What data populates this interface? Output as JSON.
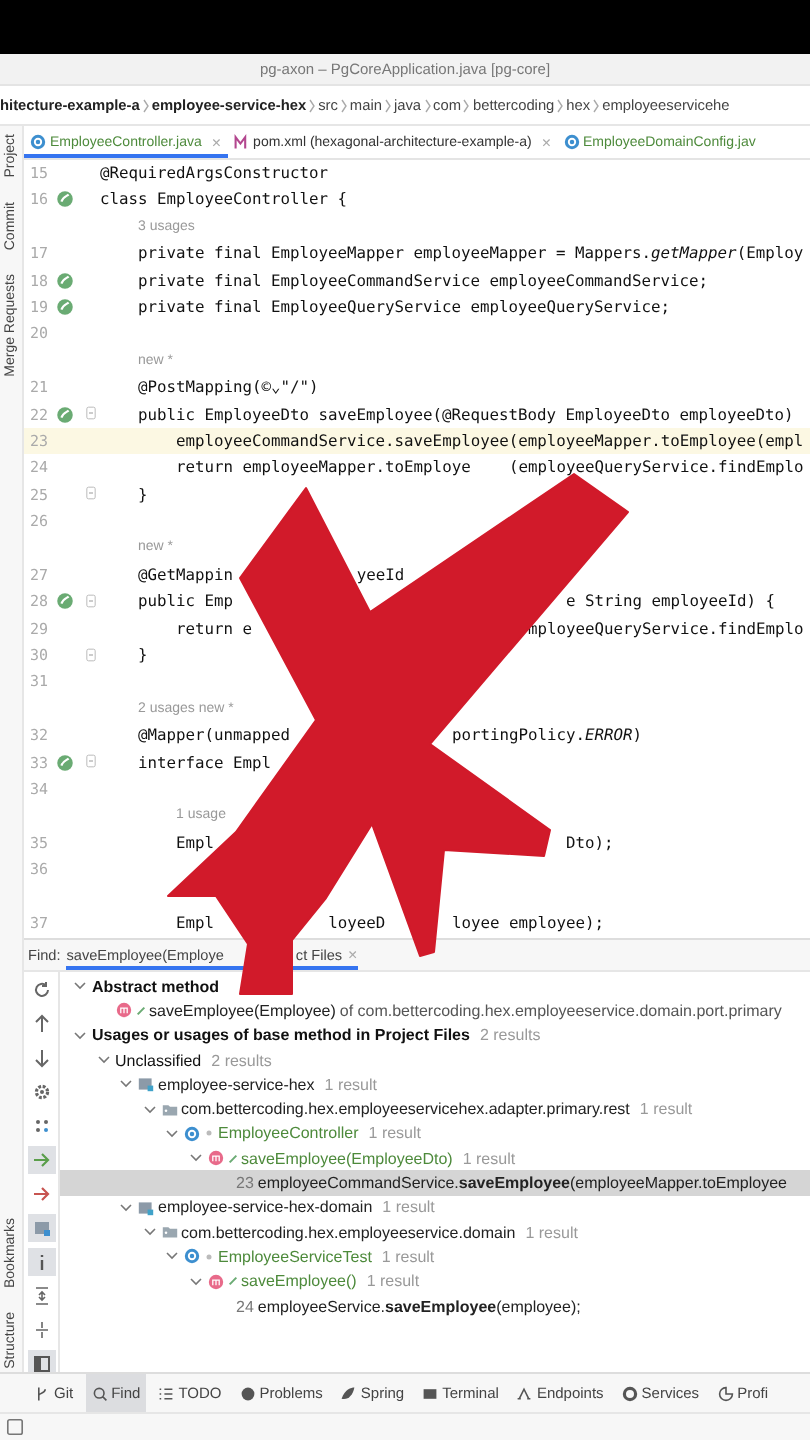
{
  "window": {
    "title": "pg-axon – PgCoreApplication.java [pg-core]"
  },
  "breadcrumb": [
    {
      "label": "hitecture-example-a",
      "bold": true
    },
    {
      "label": "employee-service-hex",
      "bold": true
    },
    {
      "label": "src",
      "bold": false
    },
    {
      "label": "main",
      "bold": false
    },
    {
      "label": "java",
      "bold": false
    },
    {
      "label": "com",
      "bold": false
    },
    {
      "label": "bettercoding",
      "bold": false
    },
    {
      "label": "hex",
      "bold": false
    },
    {
      "label": "employeeservicehe",
      "bold": false
    }
  ],
  "side_strip": {
    "top": [
      "Project",
      "Commit",
      "Merge Requests"
    ],
    "bottom": [
      "Bookmarks",
      "Structure"
    ]
  },
  "tabs": [
    {
      "kind": "class",
      "label": "EmployeeController.java",
      "close": "×",
      "selected": true
    },
    {
      "kind": "maven",
      "label": "pom.xml (hexagonal-architecture-example-a)",
      "close": "×",
      "selected": false
    },
    {
      "kind": "class",
      "label": "EmployeeDomainConfig.jav",
      "selected": false
    }
  ],
  "editor": {
    "lines": [
      {
        "kind": "code",
        "number": "15",
        "pieces": [
          "@RequiredArgsConstructor"
        ]
      },
      {
        "kind": "code",
        "number": "16",
        "gutter_icon": true,
        "pieces": [
          "class EmployeeController {"
        ]
      },
      {
        "kind": "hint",
        "text": "3 usages"
      },
      {
        "kind": "code",
        "number": "17",
        "pieces": [
          "private final EmployeeMapper employeeMapper = Mappers.*getMapper*(Employ"
        ]
      },
      {
        "kind": "code",
        "number": "18",
        "gutter_icon": true,
        "pieces": [
          "private final EmployeeCommandService employeeCommandService;"
        ]
      },
      {
        "kind": "code",
        "number": "19",
        "gutter_icon": true,
        "pieces": [
          "private final EmployeeQueryService employeeQueryService;"
        ]
      },
      {
        "kind": "code",
        "number": "20"
      },
      {
        "kind": "hint",
        "text": "new *"
      },
      {
        "kind": "code",
        "number": "21",
        "pieces": [
          "@PostMapping(©⌄\"/\")"
        ]
      },
      {
        "kind": "code",
        "number": "22",
        "gutter_icon": true,
        "fold": true,
        "pieces": [
          "public EmployeeDto saveEmployee(@RequestBody EmployeeDto employeeDto)"
        ]
      },
      {
        "kind": "code",
        "number": "23",
        "current": true,
        "pieces": [
          "employeeCommandService.saveEmployee(employeeMapper.toEmployee(empl"
        ]
      },
      {
        "kind": "code",
        "number": "24",
        "pieces": [
          "return employeeMapper.toEmploye",
          "(employeeQueryService.findEmplo"
        ]
      },
      {
        "kind": "code",
        "number": "25",
        "fold": true,
        "pieces": [
          "}"
        ]
      },
      {
        "kind": "code",
        "number": "26"
      },
      {
        "kind": "hint",
        "text": "new *"
      },
      {
        "kind": "code",
        "number": "27",
        "pieces": [
          "@GetMappin",
          "yeeId"
        ]
      },
      {
        "kind": "code",
        "number": "28",
        "gutter_icon": true,
        "fold": true,
        "pieces": [
          "public Emp",
          "e String employeeId) {"
        ]
      },
      {
        "kind": "code",
        "number": "29",
        "pieces": [
          "return e",
          "mployeeQueryService.findEmplo"
        ]
      },
      {
        "kind": "code",
        "number": "30",
        "fold": true,
        "pieces": [
          "}"
        ]
      },
      {
        "kind": "code",
        "number": "31"
      },
      {
        "kind": "hint",
        "text": "2 usages   new *"
      },
      {
        "kind": "code",
        "number": "32",
        "pieces": [
          "@Mapper(unmapped",
          "portingPolicy.*ERROR*)"
        ]
      },
      {
        "kind": "code",
        "number": "33",
        "gutter_icon": true,
        "fold": true,
        "pieces": [
          "interface Empl"
        ]
      },
      {
        "kind": "code",
        "number": "34"
      },
      {
        "kind": "hint",
        "text": "1 usage"
      },
      {
        "kind": "code",
        "number": "35",
        "pieces": [
          "Empl",
          "Dto);"
        ]
      },
      {
        "kind": "code",
        "number": "36"
      },
      {
        "kind": "hint"
      },
      {
        "kind": "code",
        "number": "37",
        "pieces": [
          "Empl",
          "loyeeD",
          "loyee employee);"
        ]
      }
    ]
  },
  "find": {
    "label": "Find:",
    "tab": {
      "pieces": [
        "saveEmployee(Employe",
        "ct Files"
      ],
      "close": "×"
    },
    "tree": [
      {
        "kind": "group",
        "label": "Abstract method",
        "bold": true,
        "expanded": true,
        "children": [
          {
            "kind": "method",
            "label": "saveEmployee(Employee)",
            "detail": "of com.bettercoding.hex.employeeservice.domain.port.primary",
            "added": false
          }
        ]
      },
      {
        "kind": "group",
        "label": "Usages or usages of base method in Project Files",
        "bold": true,
        "count": "2 results",
        "expanded": true,
        "children": [
          {
            "kind": "group",
            "label": "Unclassified",
            "bold": false,
            "count": "2 results",
            "expanded": true,
            "children": [
              {
                "kind": "module",
                "label": "employee-service-hex",
                "count": "1 result",
                "expanded": true,
                "children": [
                  {
                    "kind": "package",
                    "label": "com.bettercoding.hex.employeeservicehex.adapter.primary.rest",
                    "count": "1 result",
                    "expanded": true,
                    "children": [
                      {
                        "kind": "class",
                        "label": "EmployeeController",
                        "count": "1 result",
                        "added": true,
                        "expanded": true,
                        "children": [
                          {
                            "kind": "method",
                            "label": "saveEmployee(EmployeeDto)",
                            "count": "1 result",
                            "added": true,
                            "expanded": true,
                            "children": [
                              {
                                "kind": "usage",
                                "line": "23",
                                "label": "employeeCommandService.**saveEmployee**(employeeMapper.toEmployee",
                                "selected": true
                              }
                            ]
                          }
                        ]
                      }
                    ]
                  }
                ]
              },
              {
                "kind": "module",
                "label": "employee-service-hex-domain",
                "count": "1 result",
                "expanded": true,
                "children": [
                  {
                    "kind": "package",
                    "label": "com.bettercoding.hex.employeeservice.domain",
                    "count": "1 result",
                    "expanded": true,
                    "children": [
                      {
                        "kind": "class",
                        "label": "EmployeeServiceTest",
                        "count": "1 result",
                        "added": true,
                        "expanded": true,
                        "children": [
                          {
                            "kind": "method",
                            "label": "saveEmployee()",
                            "count": "1 result",
                            "added": true,
                            "expanded": true,
                            "children": [
                              {
                                "kind": "usage",
                                "line": "24",
                                "label": "employeeService.**saveEmployee**(employee);",
                                "selected": false
                              }
                            ]
                          }
                        ]
                      }
                    ]
                  }
                ]
              }
            ]
          }
        ]
      }
    ]
  },
  "toolbar": [
    {
      "kind": "git",
      "label": "Git",
      "selected": false
    },
    {
      "kind": "find",
      "label": "Find",
      "selected": true
    },
    {
      "kind": "todo",
      "label": "TODO",
      "selected": false
    },
    {
      "kind": "problems",
      "label": "Problems",
      "selected": false
    },
    {
      "kind": "spring",
      "label": "Spring",
      "selected": false
    },
    {
      "kind": "terminal",
      "label": "Terminal",
      "selected": false
    },
    {
      "kind": "endpoints",
      "label": "Endpoints",
      "selected": false
    },
    {
      "kind": "services",
      "label": "Services",
      "selected": false
    },
    {
      "kind": "profiler",
      "label": "Profi",
      "selected": false
    }
  ]
}
